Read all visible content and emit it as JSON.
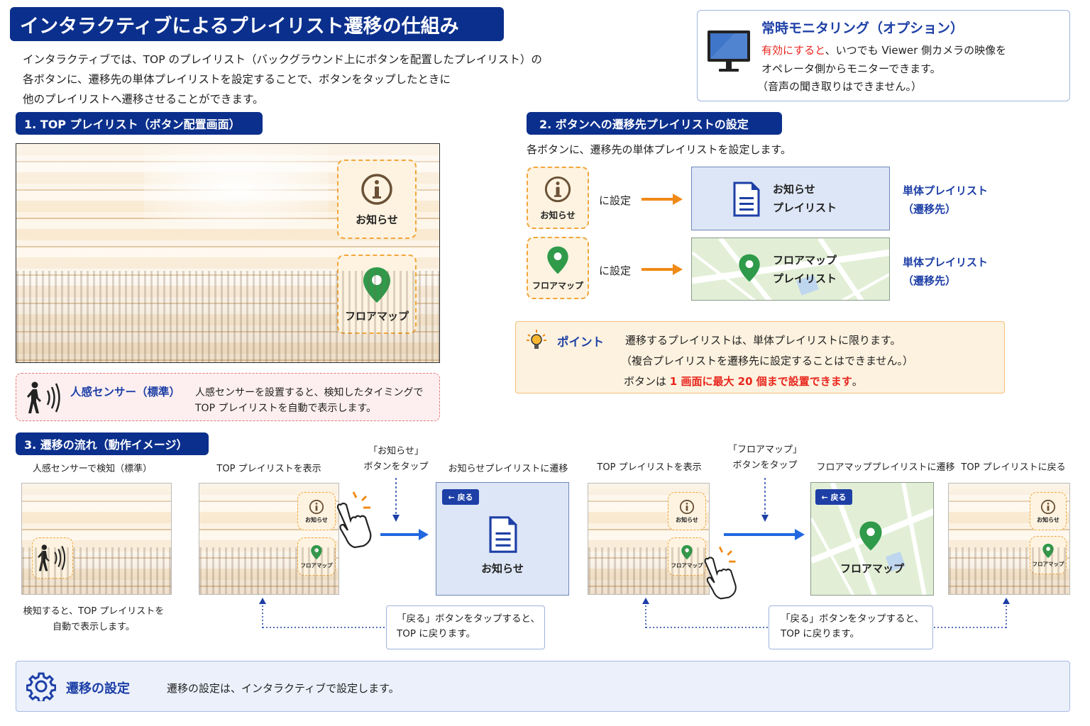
{
  "title": "インタラクティブによるプレイリスト遷移の仕組み",
  "intro": [
    "インタラクティブでは、TOP のプレイリスト（バックグラウンド上にボタンを配置したプレイリスト）の",
    "各ボタンに、遷移先の単体プレイリストを設定することで、ボタンをタップしたときに",
    "他のプレイリストへ遷移させることができます。"
  ],
  "monitoring": {
    "title": "常時モニタリング（オプション）",
    "line1_red": "有効にすると",
    "line1_rest": "、いつでも Viewer 側カメラの映像を",
    "line2": "オペレータ側からモニターできます。",
    "line3": "（音声の聞き取りはできません。）",
    "icon": "monitor-icon"
  },
  "section1": {
    "header": "1. TOP プレイリスト（ボタン配置画面）",
    "btn_info": "お知らせ",
    "btn_map": "フロアマップ"
  },
  "sensor": {
    "title": "人感センサー（標準）",
    "line1": "人感センサーを設置すると、検知したタイミングで",
    "line2": "TOP プレイリストを自動で表示します。",
    "icon": "motion-sensor-icon"
  },
  "section2": {
    "header": "2. ボタンへの遷移先プレイリストの設定",
    "desc": "各ボタンに、遷移先の単体プレイリストを設定します。",
    "rows": [
      {
        "button": "お知らせ",
        "set": "に設定",
        "pl1": "お知らせ",
        "pl2": "プレイリスト",
        "lbl1": "単体プレイリスト",
        "lbl2": "（遷移先）"
      },
      {
        "button": "フロアマップ",
        "set": "に設定",
        "pl1": "フロアマップ",
        "pl2": "プレイリスト",
        "lbl1": "単体プレイリスト",
        "lbl2": "（遷移先）"
      }
    ]
  },
  "point": {
    "label": "ポイント",
    "line1": "遷移するプレイリストは、単体プレイリストに限ります。",
    "line2": "（複合プレイリストを遷移先に設定することはできません。）",
    "line3_pre": "ボタンは ",
    "line3_red": "1 画面に最大 20 個まで設置できます",
    "line3_post": "。",
    "icon": "lightbulb-icon"
  },
  "section3": {
    "header": "3. 遷移の流れ（動作イメージ）",
    "cap_sensor": "人感センサーで検知（標準）",
    "cap_top1": "TOP プレイリストを表示",
    "tap_info_1": "「お知らせ」",
    "tap_info_2": "ボタンをタップ",
    "cap_info_pl": "お知らせプレイリストに遷移",
    "cap_top2": "TOP プレイリストを表示",
    "tap_map_1": "「フロアマップ」",
    "tap_map_2": "ボタンをタップ",
    "cap_map_pl": "フロアマッププレイリストに遷移",
    "cap_back": "TOP プレイリストに戻る",
    "sensor_note1": "検知すると、TOP プレイリストを",
    "sensor_note2": "自動で表示します。",
    "back_btn": "← 戻る",
    "screen_info": "お知らせ",
    "screen_map": "フロアマップ",
    "small_info": "お知らせ",
    "small_map": "フロアマップ",
    "back_note1": "「戻る」ボタンをタップすると、",
    "back_note2": "TOP に戻ります。"
  },
  "settings": {
    "title": "遷移の設定",
    "desc": "遷移の設定は、インタラクティブで設定します。",
    "icon": "gear-icon"
  },
  "colors": {
    "navy": "#0b2f8c",
    "accent": "#1d3fa6",
    "orange": "#f08a17",
    "red": "#e8251d",
    "green": "#2f9a4a"
  }
}
